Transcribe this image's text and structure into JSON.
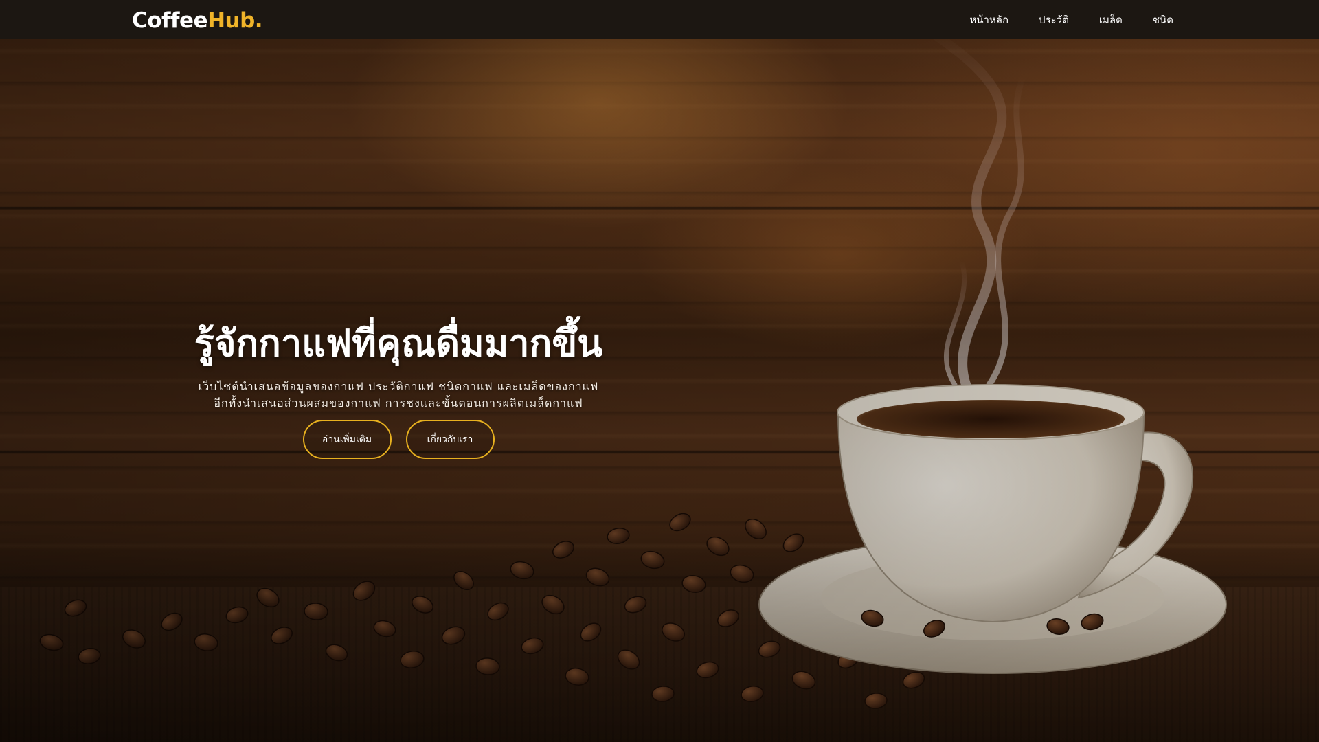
{
  "brand": {
    "name_main": "Coffee",
    "name_accent": "Hub.",
    "accent_color": "#f0b429"
  },
  "nav": {
    "items": [
      {
        "label": "หน้าหลัก"
      },
      {
        "label": "ประวัติ"
      },
      {
        "label": "เมล็ด"
      },
      {
        "label": "ชนิด"
      }
    ]
  },
  "hero": {
    "title": "รู้จักกาแฟที่คุณดื่มมากขึ้น",
    "description_line1": "เว็บไซต์นำเสนอข้อมูลของกาแฟ ประวัติกาแฟ ชนิดกาแฟ และเมล็ดของกาแฟ",
    "description_line2": "อีกทั้งนำเสนอส่วนผสมของกาแฟ การชงและขั้นตอนการผลิตเมล็ดกาแฟ",
    "buttons": {
      "read_more": "อ่านเพิ่มเติม",
      "about_us": "เกี่ยวกับเรา"
    },
    "button_border_color": "#e8b11f",
    "background_image": "coffee-cup-and-beans-on-wood"
  },
  "colors": {
    "navbar_bg": "#1c1712",
    "text_light": "#ffffff"
  }
}
